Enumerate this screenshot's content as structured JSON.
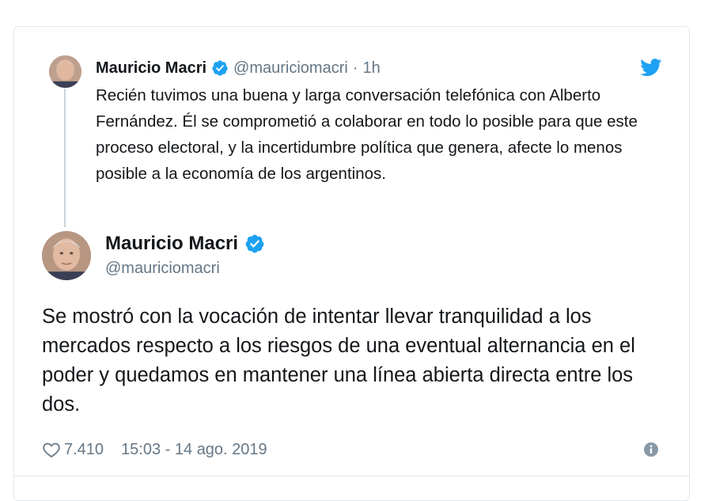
{
  "quoted_tweet": {
    "author_name": "Mauricio Macri",
    "handle": "@mauriciomacri",
    "separator": "·",
    "time": "1h",
    "text": "Recién tuvimos una buena y larga conversación telefónica con Alberto Fernández. Él se comprometió a colaborar en todo lo posible para que este proceso electoral, y la incertidumbre política que genera, afecte lo menos posible a la economía de los argentinos."
  },
  "main_tweet": {
    "author_name": "Mauricio Macri",
    "handle": "@mauriciomacri",
    "text": "Se mostró con la vocación de intentar llevar tranquilidad a los mercados respecto a los riesgos de una eventual alternancia en el poder y quedamos en mantener una línea abierta directa entre los dos."
  },
  "footer": {
    "likes": "7.410",
    "timestamp": "15:03 - 14 ago. 2019"
  },
  "icons": {
    "verified": "verified-badge-icon",
    "brand": "twitter-bird-icon",
    "like": "heart-icon",
    "info": "info-icon"
  },
  "colors": {
    "brand_blue": "#1da1f2",
    "text": "#14171a",
    "secondary_text": "#657786",
    "border": "#e1e8ed"
  }
}
